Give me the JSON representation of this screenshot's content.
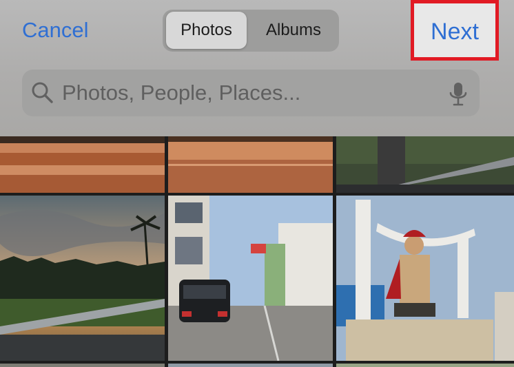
{
  "header": {
    "cancel_label": "Cancel",
    "next_label": "Next",
    "segments": [
      {
        "label": "Photos",
        "selected": true
      },
      {
        "label": "Albums",
        "selected": false
      }
    ]
  },
  "search": {
    "placeholder": "Photos, People, Places...",
    "icon": "search-icon",
    "mic_icon": "microphone-icon"
  },
  "colors": {
    "accent": "#2f6fd3",
    "highlight_border": "#e11a24"
  }
}
